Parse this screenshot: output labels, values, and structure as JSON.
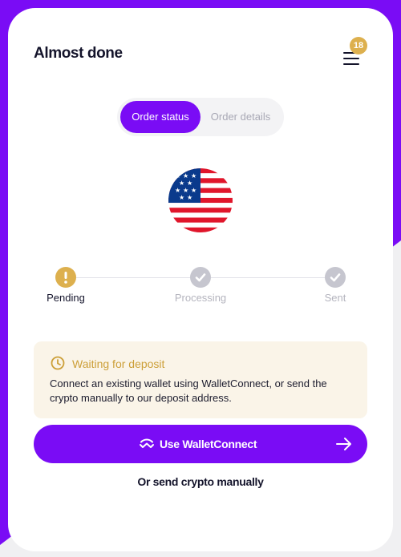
{
  "header": {
    "title": "Almost done",
    "menu_icon": "hamburger-menu-icon",
    "menu_badge_count": "18",
    "badge_color": "#ddb04e"
  },
  "tabs": [
    {
      "label": "Order status",
      "active": true
    },
    {
      "label": "Order details",
      "active": false
    }
  ],
  "currency_flag": "us-flag-icon",
  "steps": [
    {
      "label": "Pending",
      "state": "current",
      "icon": "exclamation-icon"
    },
    {
      "label": "Processing",
      "state": "upcoming",
      "icon": "check-icon"
    },
    {
      "label": "Sent",
      "state": "upcoming",
      "icon": "check-icon"
    }
  ],
  "notice": {
    "icon": "clock-icon",
    "title": "Waiting for deposit",
    "body": "Connect an existing wallet using WalletConnect, or send the crypto manually to our deposit address."
  },
  "actions": {
    "wallet_connect_label": "Use WalletConnect",
    "wallet_connect_icon": "walletconnect-icon",
    "arrow_icon": "arrow-right-icon",
    "manual_label": "Or send crypto manually"
  },
  "colors": {
    "accent": "#7a0cf5",
    "warning": "#ddb04e",
    "inactive": "#c6c6cf",
    "notice_bg": "#faf4e8"
  }
}
